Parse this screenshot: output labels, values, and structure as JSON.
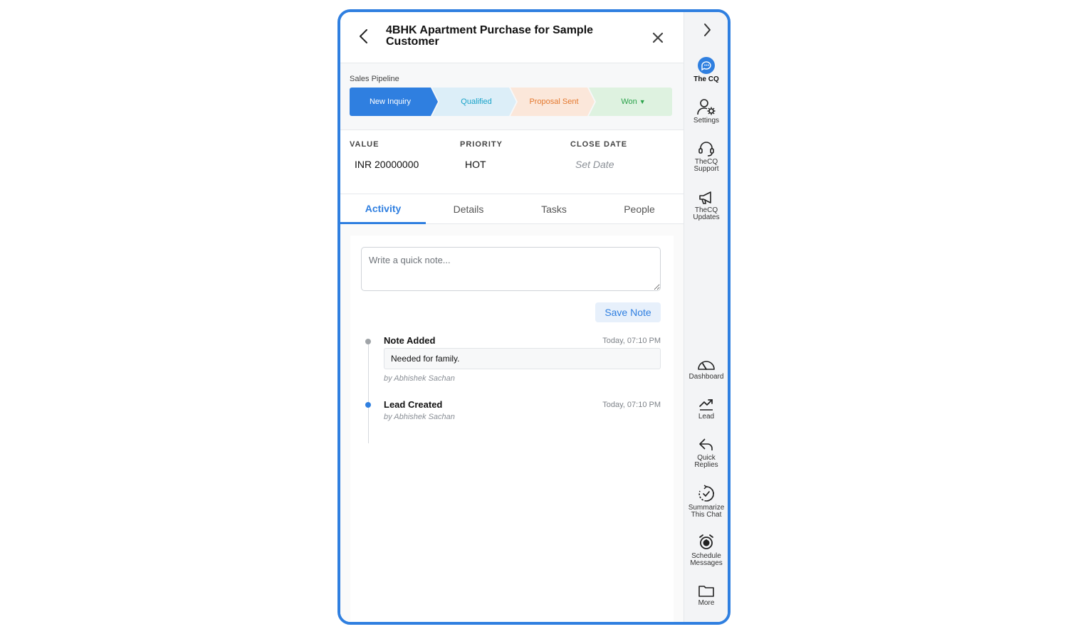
{
  "header": {
    "title": "4BHK Apartment Purchase for Sample Customer"
  },
  "pipeline": {
    "label": "Sales Pipeline",
    "stages": [
      {
        "label": "New Inquiry",
        "active": true
      },
      {
        "label": "Qualified"
      },
      {
        "label": "Proposal Sent"
      },
      {
        "label": "Won"
      }
    ],
    "won_caret": "▼"
  },
  "meta": {
    "value_label": "VALUE",
    "value": "INR 20000000",
    "priority_label": "PRIORITY",
    "priority": "HOT",
    "close_date_label": "CLOSE DATE",
    "close_date": "Set Date"
  },
  "tabs": [
    {
      "label": "Activity",
      "active": true
    },
    {
      "label": "Details"
    },
    {
      "label": "Tasks"
    },
    {
      "label": "People"
    }
  ],
  "activity": {
    "note_placeholder": "Write a quick note...",
    "save_label": "Save Note",
    "events": [
      {
        "title": "Note Added",
        "time": "Today, 07:10 PM",
        "note": "Needed for family.",
        "by": "by Abhishek Sachan"
      },
      {
        "title": "Lead Created",
        "time": "Today, 07:10 PM",
        "by": "by Abhishek Sachan"
      }
    ]
  },
  "rail": {
    "items": [
      {
        "label": "The CQ",
        "icon": "chat-bubble-icon"
      },
      {
        "label": "Settings",
        "icon": "user-gear-icon"
      },
      {
        "label_1": "TheCQ",
        "label_2": "Support",
        "icon": "headset-icon"
      },
      {
        "label_1": "TheCQ",
        "label_2": "Updates",
        "icon": "megaphone-icon"
      },
      {
        "label": "Dashboard",
        "icon": "gauge-icon"
      },
      {
        "label": "Lead",
        "icon": "trend-up-icon"
      },
      {
        "label_1": "Quick",
        "label_2": "Replies",
        "icon": "reply-icon"
      },
      {
        "label_1": "Summarize",
        "label_2": "This Chat",
        "icon": "summarize-icon"
      },
      {
        "label_1": "Schedule",
        "label_2": "Messages",
        "icon": "alarm-clock-icon"
      },
      {
        "label": "More",
        "icon": "folder-icon"
      }
    ]
  },
  "colors": {
    "accent": "#2f7fe0",
    "qualified": "#17a2c8",
    "proposal": "#e4782e",
    "won": "#2aa24a"
  }
}
